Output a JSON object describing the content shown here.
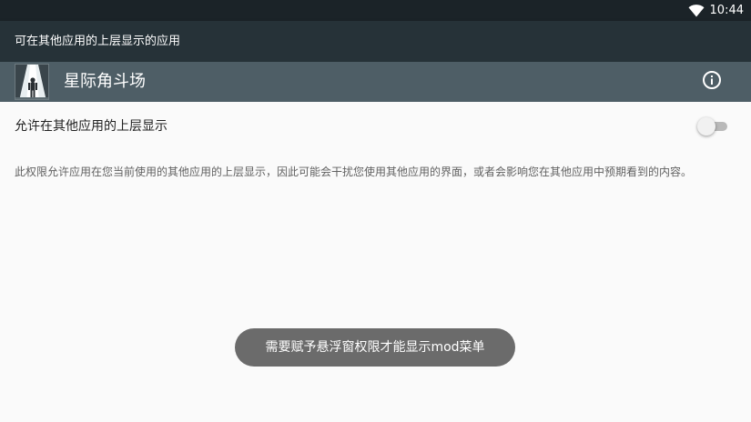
{
  "status_bar": {
    "time": "10:44",
    "icons": [
      "wifi-icon"
    ]
  },
  "toolbar": {
    "title": "可在其他应用的上层显示的应用"
  },
  "app_header": {
    "app_name": "星际角斗场",
    "icon": "app-icon",
    "info_icon": "info-icon"
  },
  "permission": {
    "label": "允许在其他应用的上层显示",
    "enabled": false,
    "description": "此权限允许应用在您当前使用的其他应用的上层显示，因此可能会干扰您使用其他应用的界面，或者会影响您在其他应用中预期看到的内容。"
  },
  "toast": {
    "message": "需要赋予悬浮窗权限才能显示mod菜单"
  },
  "colors": {
    "status_bar": "#1b2328",
    "toolbar": "#263238",
    "app_header": "#4e5e66",
    "background": "#fafafa",
    "toast": "#6b6b6b"
  }
}
